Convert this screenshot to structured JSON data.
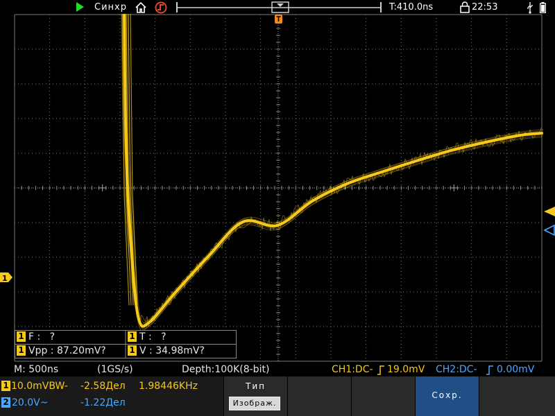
{
  "top_bar": {
    "sync_label": "Синхр",
    "time_position": "T:410.0ns",
    "clock": "22:53",
    "colors": {
      "run": "#22dd22",
      "trigger_icon": "#e04a2a"
    },
    "icons": [
      "play-icon",
      "home-icon",
      "trigger-icon",
      "lock-icon",
      "usb-icon",
      "battery-icon"
    ]
  },
  "measurements": {
    "freq_label": "F :",
    "freq_value": "?",
    "period_label": "T :",
    "period_value": "?",
    "vpp_label": "Vpp :",
    "vpp_value": "87.20mV?",
    "v_label": "V :",
    "v_value": "34.98mV?",
    "channel_badge": "1"
  },
  "status": {
    "timebase": "M: 500ns",
    "sample_rate": "(1GS/s)",
    "depth": "Depth:100K(8-bit)",
    "ch1_trigger": "CH1:DC-",
    "ch1_level": "19.0mV",
    "ch2_trigger": "CH2:DC-",
    "ch2_level": "0.00mV"
  },
  "channels": {
    "ch1": {
      "badge": "1",
      "scale": "10.0mV",
      "coupling": "BW-",
      "offset": "-2.58Дел",
      "frequency": "1.98446KHz",
      "color": "#f6c91a"
    },
    "ch2": {
      "badge": "2",
      "scale": "20.0V~",
      "offset": "-1.22Дел",
      "color": "#4aa8ff"
    }
  },
  "menu": {
    "type_label": "Тип",
    "type_value": "Изображ.",
    "save_label": "Сохр."
  },
  "trace": {
    "color": "#f6c91a",
    "grid_color": "#7a7a7a",
    "description_points": [
      [
        179,
        1
      ],
      [
        182,
        200
      ],
      [
        190,
        350
      ],
      [
        200,
        440
      ],
      [
        215,
        445
      ],
      [
        250,
        405
      ],
      [
        300,
        350
      ],
      [
        350,
        300
      ],
      [
        400,
        305
      ],
      [
        450,
        270
      ],
      [
        500,
        245
      ],
      [
        550,
        228
      ],
      [
        600,
        212
      ],
      [
        650,
        197
      ],
      [
        700,
        185
      ],
      [
        750,
        175
      ],
      [
        781,
        172
      ]
    ]
  }
}
